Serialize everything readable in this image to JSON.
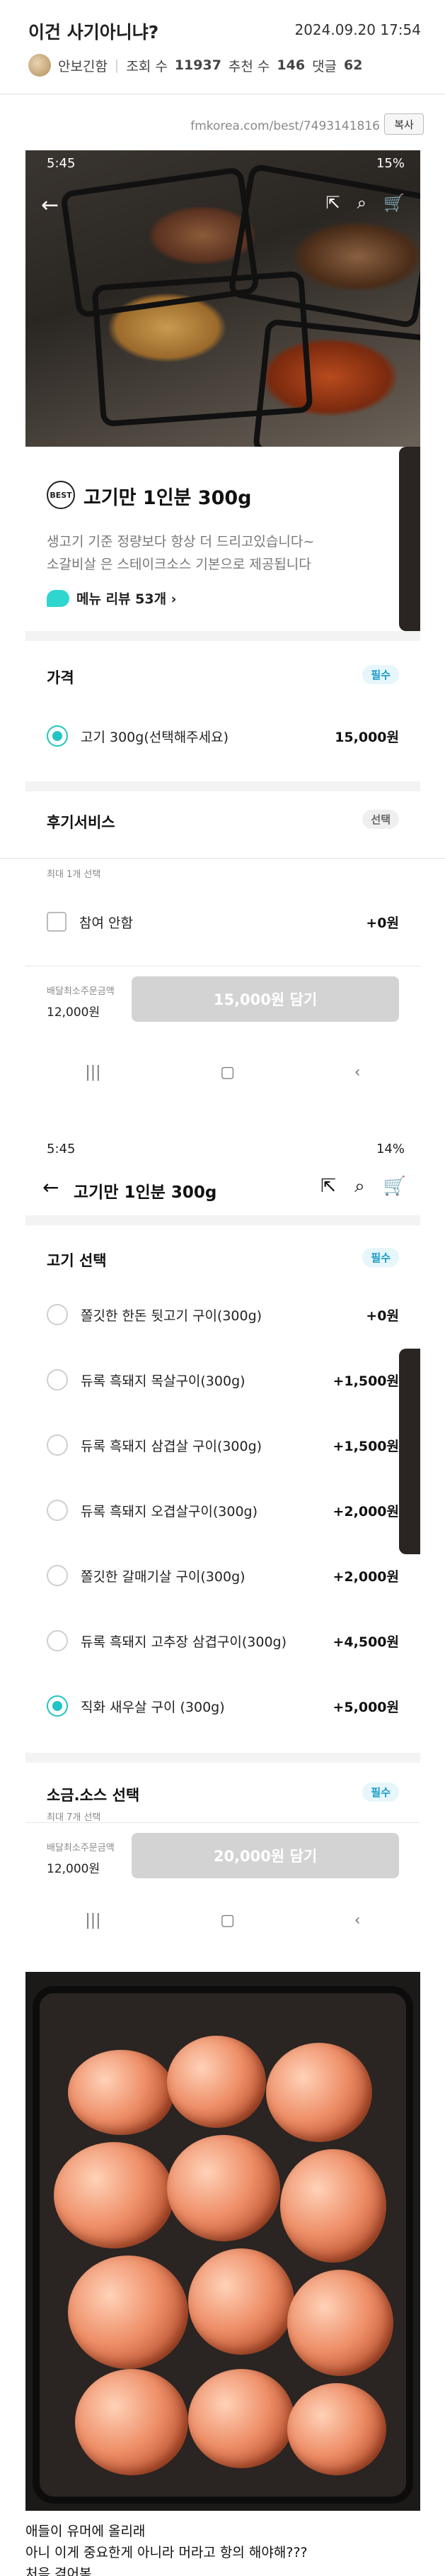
{
  "post": {
    "title": "이건 사기아니냐?",
    "date": "2024.09.20 17:54",
    "author": "안보긴함",
    "views_label": "조회 수",
    "views": "11937",
    "recommend_label": "추천 수",
    "recommend": "146",
    "comments_label": "댓글",
    "comments": "62",
    "source_url": "fmkorea.com/best/7493141816",
    "copy_label": "복사"
  },
  "shot1": {
    "time": "5:45",
    "battery": "15%",
    "best_badge": "BEST",
    "product_name": "고기만 1인분 300g",
    "desc_line1": "생고기 기준 정량보다 항상 더 드리고있습니다~",
    "desc_line2": "소갈비살 은 스테이크소스 기본으로 제공됩니다",
    "review_link": "메뉴 리뷰 53개 ›",
    "price_title": "가격",
    "required_badge": "필수",
    "price_option": {
      "label": "고기 300g(선택해주세요)",
      "price": "15,000원"
    },
    "after_title": "후기서비스",
    "optional_badge": "선택",
    "max_note": "최대 1개 선택",
    "checkbox_option": {
      "label": "참여 안함",
      "price": "+0원"
    },
    "min_order_label": "배달최소주문금액",
    "min_order_value": "12,000원",
    "cart_button": "15,000원 담기"
  },
  "shot2": {
    "time": "5:45",
    "battery": "14%",
    "app_title": "고기만 1인분 300g",
    "select_title": "고기 선택",
    "required_badge": "필수",
    "options": [
      {
        "label": "쫄깃한 한돈 뒷고기 구이(300g)",
        "price": "+0원",
        "selected": false
      },
      {
        "label": "듀록 흑돼지 목살구이(300g)",
        "price": "+1,500원",
        "selected": false
      },
      {
        "label": "듀록 흑돼지 삼겹살 구이(300g)",
        "price": "+1,500원",
        "selected": false
      },
      {
        "label": "듀록 흑돼지 오겹살구이(300g)",
        "price": "+2,000원",
        "selected": false
      },
      {
        "label": "쫄깃한 갈매기살 구이(300g)",
        "price": "+2,000원",
        "selected": false
      },
      {
        "label": "듀록 흑돼지 고추장 삼겹구이(300g)",
        "price": "+4,500원",
        "selected": false
      },
      {
        "label": "직화 새우살 구이 (300g)",
        "price": "+5,000원",
        "selected": true
      }
    ],
    "sauce_title": "소금.소스 선택",
    "sauce_badge": "필수",
    "sauce_note": "최대 7개 선택",
    "min_order_label": "배달최소주문금액",
    "min_order_value": "12,000원",
    "cart_button": "20,000원 담기"
  },
  "nav": {
    "recent": "|||",
    "home": "▢",
    "back": "‹"
  },
  "caption": {
    "line1": "애들이 유머에 올리래",
    "line2": "아니 이게 중요한게 아니라 머라고 항의 해야해???",
    "line3": "처음 겪어봄"
  }
}
